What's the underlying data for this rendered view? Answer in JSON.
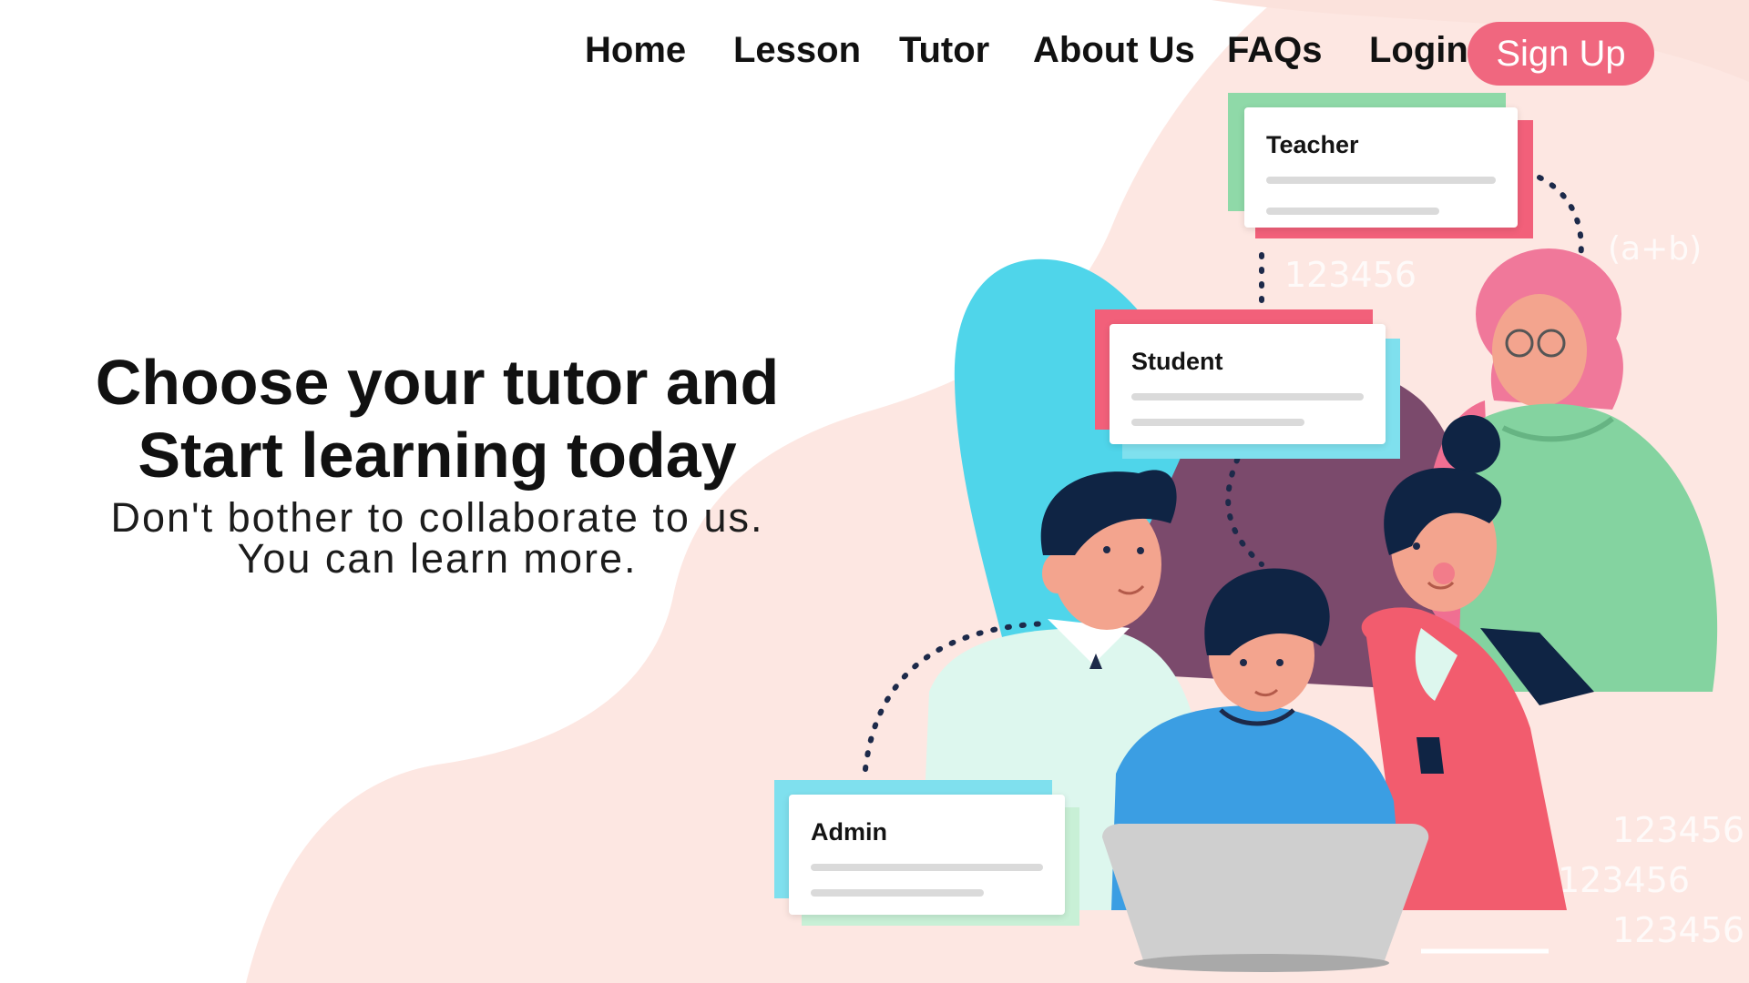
{
  "nav": {
    "items": [
      {
        "label": "Home"
      },
      {
        "label": "Lesson"
      },
      {
        "label": "Tutor"
      },
      {
        "label": "About Us"
      },
      {
        "label": "FAQs"
      },
      {
        "label": "Login"
      }
    ],
    "signup_label": "Sign Up"
  },
  "hero": {
    "title_line1": "Choose your tutor and",
    "title_line2": "Start learning today",
    "subtitle_line1": "Don't bother to collaborate to us.",
    "subtitle_line2": "You can learn more."
  },
  "illustration": {
    "cards": {
      "teacher": "Teacher",
      "student": "Student",
      "admin": "Admin"
    },
    "background_numbers": [
      "123456",
      "(a+b)",
      "123456",
      "123456",
      "123456"
    ]
  },
  "colors": {
    "accent_pink": "#f0677f",
    "blob_pink": "#fde7e2",
    "card_green": "#8fd9a8",
    "card_red": "#f2607a",
    "card_cyan": "#7fe0ee",
    "text_dark": "#111111"
  }
}
